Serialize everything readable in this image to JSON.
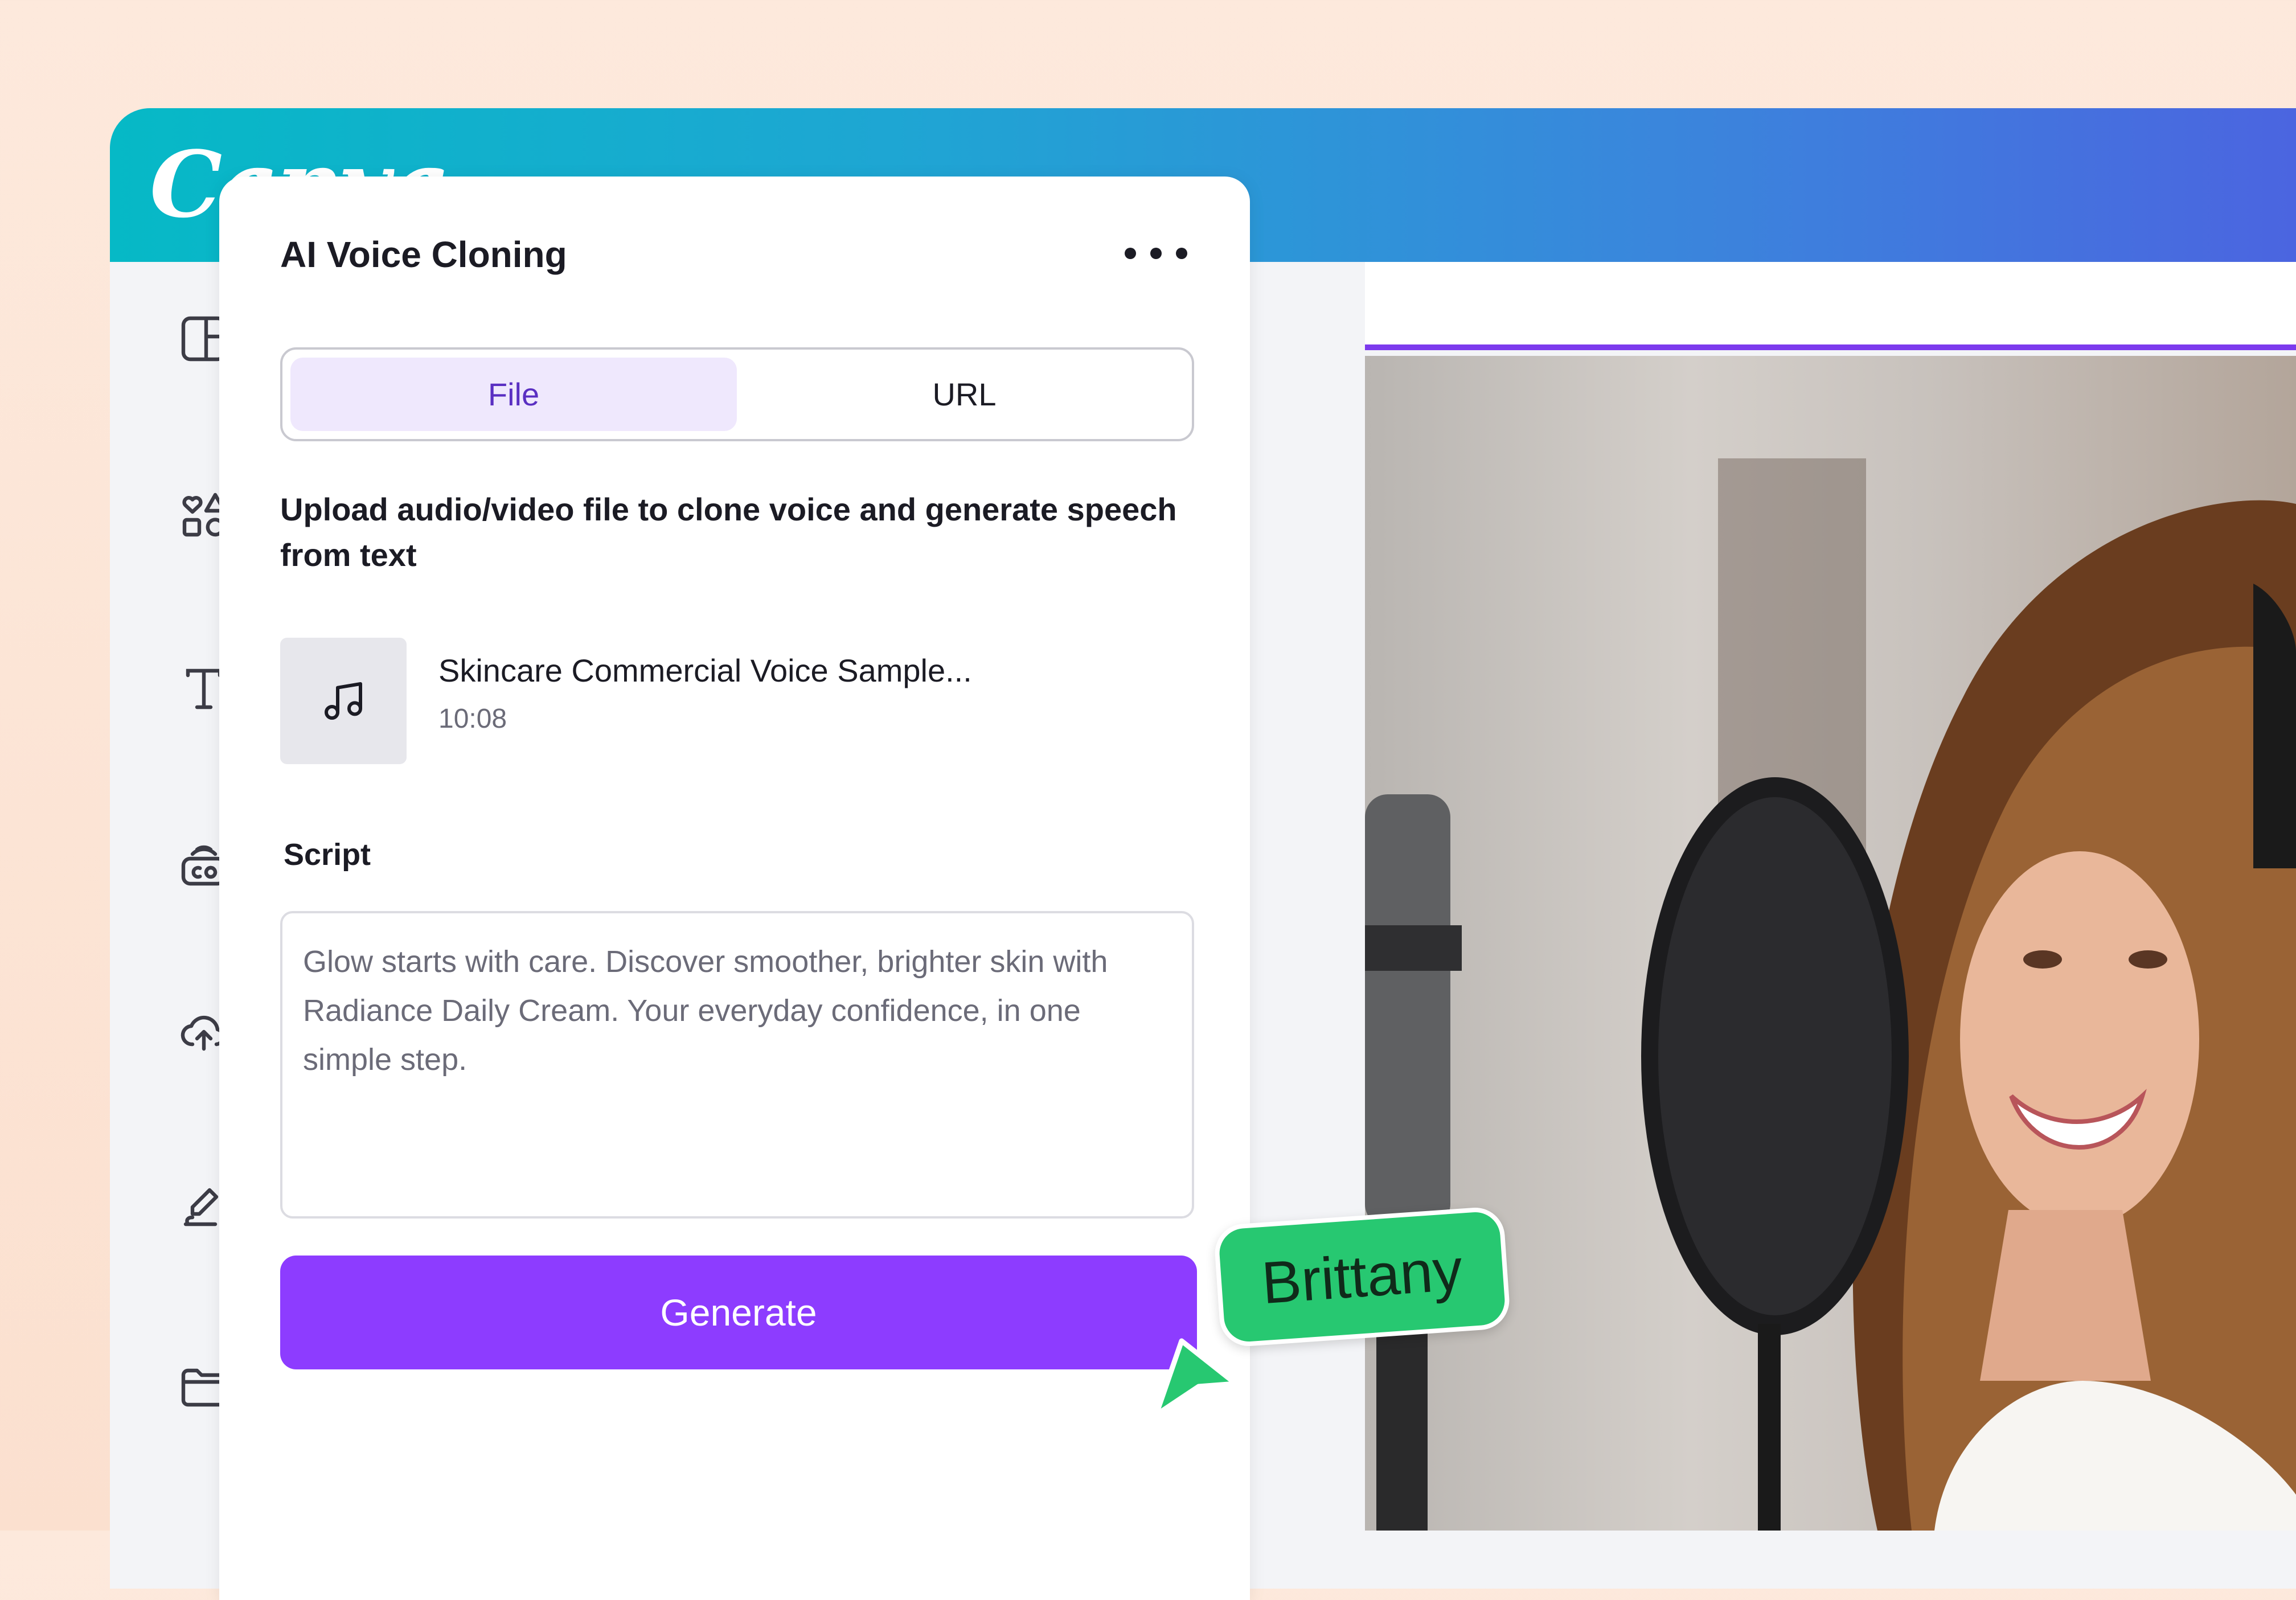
{
  "app": {
    "logo_text": "Canva"
  },
  "sidebar": {
    "items": [
      {
        "icon": "layout-icon"
      },
      {
        "icon": "elements-icon"
      },
      {
        "icon": "text-icon"
      },
      {
        "icon": "brand-icon"
      },
      {
        "icon": "upload-cloud-icon"
      },
      {
        "icon": "draw-icon"
      },
      {
        "icon": "folder-icon"
      }
    ]
  },
  "panel": {
    "title": "AI Voice Cloning",
    "tabs": {
      "file_label": "File",
      "url_label": "URL",
      "selected": "File"
    },
    "description": "Upload audio/video file to clone voice and generate speech from text",
    "file": {
      "name": "Skincare Commercial Voice Sample...",
      "duration": "10:08",
      "icon": "music-note-icon"
    },
    "script_label": "Script",
    "script_text": "Glow starts with care. Discover smoother, brighter skin with Radiance Daily Cream. Your everyday confidence, in one simple step.",
    "generate_label": "Generate"
  },
  "collaborator": {
    "name": "Brittany",
    "color": "#27c871"
  },
  "colors": {
    "accent": "#8d3cff",
    "selected_tab_bg": "#efe8fd",
    "selected_tab_text": "#5a2fc2",
    "header_gradient_start": "#06b9c6",
    "header_gradient_end": "#4c63e0"
  }
}
